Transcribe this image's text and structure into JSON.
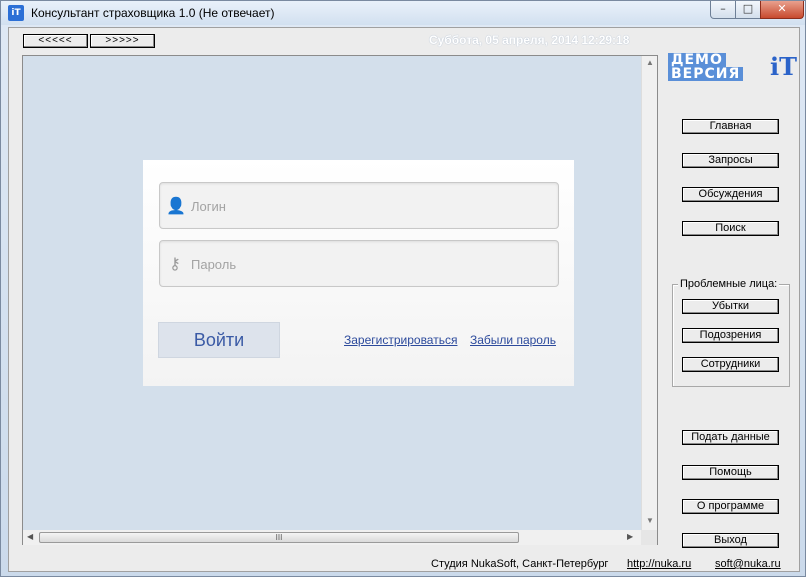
{
  "window": {
    "title": "Консультант страховщика 1.0 (Не отвечает)",
    "app_icon_text": "iT",
    "minimize_glyph": "–",
    "maximize_glyph": "□",
    "close_glyph": "✕"
  },
  "toolbar": {
    "back_label": "<<<<<",
    "forward_label": ">>>>>",
    "datetime": "Суббота, 05 апреля, 2014  12:29:18"
  },
  "demo_badge": {
    "line1": "ДЕМО",
    "line2": "ВЕРСИЯ",
    "logo": "iT"
  },
  "login": {
    "login_placeholder": "Логин",
    "password_placeholder": "Пароль",
    "submit_label": "Войти",
    "register_link": "Зарегистрироваться",
    "forgot_link": "Забыли пароль"
  },
  "sidebar": {
    "main": [
      "Главная",
      "Запросы",
      "Обсуждения",
      "Поиск"
    ],
    "group_title": "Проблемные лица:",
    "group_items": [
      "Убытки",
      "Подозрения",
      "Сотрудники"
    ],
    "bottom": [
      "Подать данные",
      "Помощь",
      "О программе",
      "Выход"
    ]
  },
  "statusbar": {
    "studio": "Студия NukaSoft, Санкт-Петербург",
    "url": "http://nuka.ru",
    "email": "soft@nuka.ru"
  },
  "scrollbars": {
    "thumb_grip": "III"
  }
}
